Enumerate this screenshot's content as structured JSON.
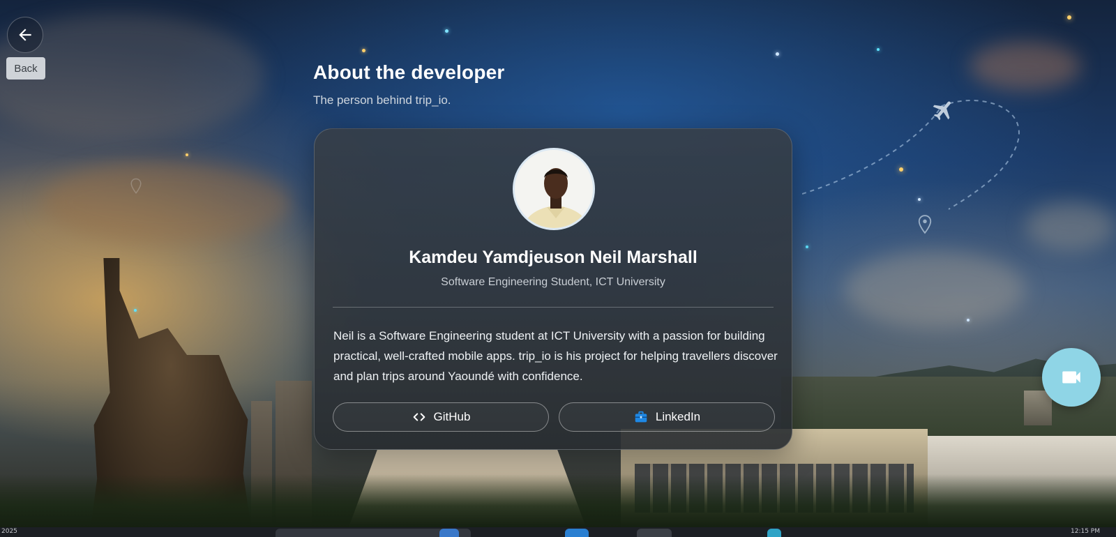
{
  "nav": {
    "back_tooltip": "Back"
  },
  "header": {
    "title": "About the developer",
    "subtitle": "The person behind trip_io."
  },
  "profile": {
    "name": "Kamdeu Yamdjeuson Neil Marshall",
    "role": "Software Engineering Student, ICT University",
    "bio": "Neil is a Software Engineering student at ICT University with a passion for building practical, well-crafted mobile apps. trip_io is his project for helping travellers discover and plan trips around Yaoundé with confidence."
  },
  "links": {
    "github_label": "GitHub",
    "linkedin_label": "LinkedIn"
  },
  "icons": {
    "back": "arrow-left-icon",
    "github": "code-icon",
    "linkedin": "briefcase-icon",
    "fab": "video-camera-icon"
  },
  "colors": {
    "fab": "#8fd5e6",
    "linkedin_icon": "#1e88e5",
    "card": "#373e46"
  },
  "taskbar": {
    "left_text": "2025",
    "right_text": "12:15 PM"
  }
}
